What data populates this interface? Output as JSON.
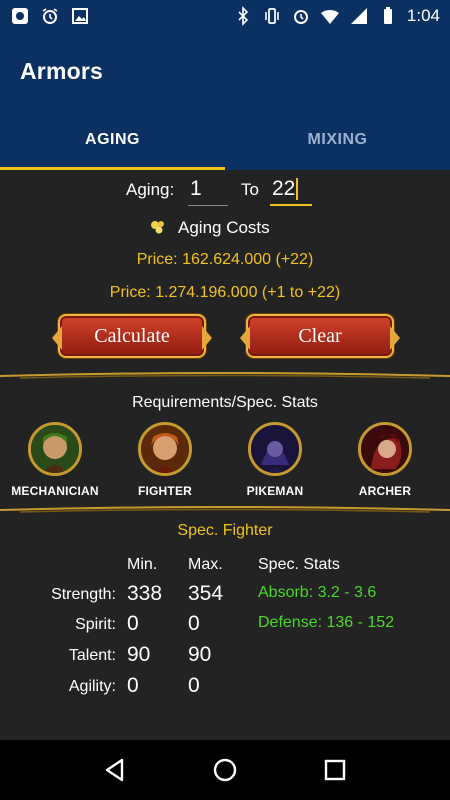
{
  "status_bar": {
    "time": "1:04",
    "icons": [
      "app-notification-icon",
      "alarm-icon",
      "image-icon",
      "bluetooth-icon",
      "vibrate-icon",
      "alarm-icon",
      "wifi-icon",
      "signal-icon",
      "battery-icon"
    ]
  },
  "app_bar": {
    "title": "Armors"
  },
  "tabs": [
    {
      "label": "AGING",
      "active": true
    },
    {
      "label": "MIXING",
      "active": false
    }
  ],
  "aging": {
    "from_label": "Aging:",
    "from_value": "1",
    "to_label": "To",
    "to_value": "22",
    "costs_label": "Aging Costs",
    "price_single": "Price: 162.624.000 (+22)",
    "price_total": "Price: 1.274.196.000 (+1 to +22)",
    "calculate_label": "Calculate",
    "clear_label": "Clear"
  },
  "requirements": {
    "title": "Requirements/Spec. Stats",
    "classes": [
      {
        "name": "MECHANICIAN",
        "color": "#3c7a1c"
      },
      {
        "name": "FIGHTER",
        "color": "#c85a18"
      },
      {
        "name": "PIKEMAN",
        "color": "#3a2a7a"
      },
      {
        "name": "ARCHER",
        "color": "#8a1c1c"
      }
    ]
  },
  "spec": {
    "title": "Spec. Fighter",
    "headers": {
      "min": "Min.",
      "max": "Max.",
      "spec": "Spec. Stats"
    },
    "rows": [
      {
        "label": "Strength:",
        "min": "338",
        "max": "354",
        "spec": "Absorb: 3.2 - 3.6"
      },
      {
        "label": "Spirit:",
        "min": "0",
        "max": "0",
        "spec": "Defense: 136 - 152"
      },
      {
        "label": "Talent:",
        "min": "90",
        "max": "90",
        "spec": ""
      },
      {
        "label": "Agility:",
        "min": "0",
        "max": "0",
        "spec": ""
      }
    ]
  },
  "colors": {
    "primary": "#0a3161",
    "accent": "#f2c21b",
    "background": "#232323",
    "spec_green": "#4bd82b"
  }
}
